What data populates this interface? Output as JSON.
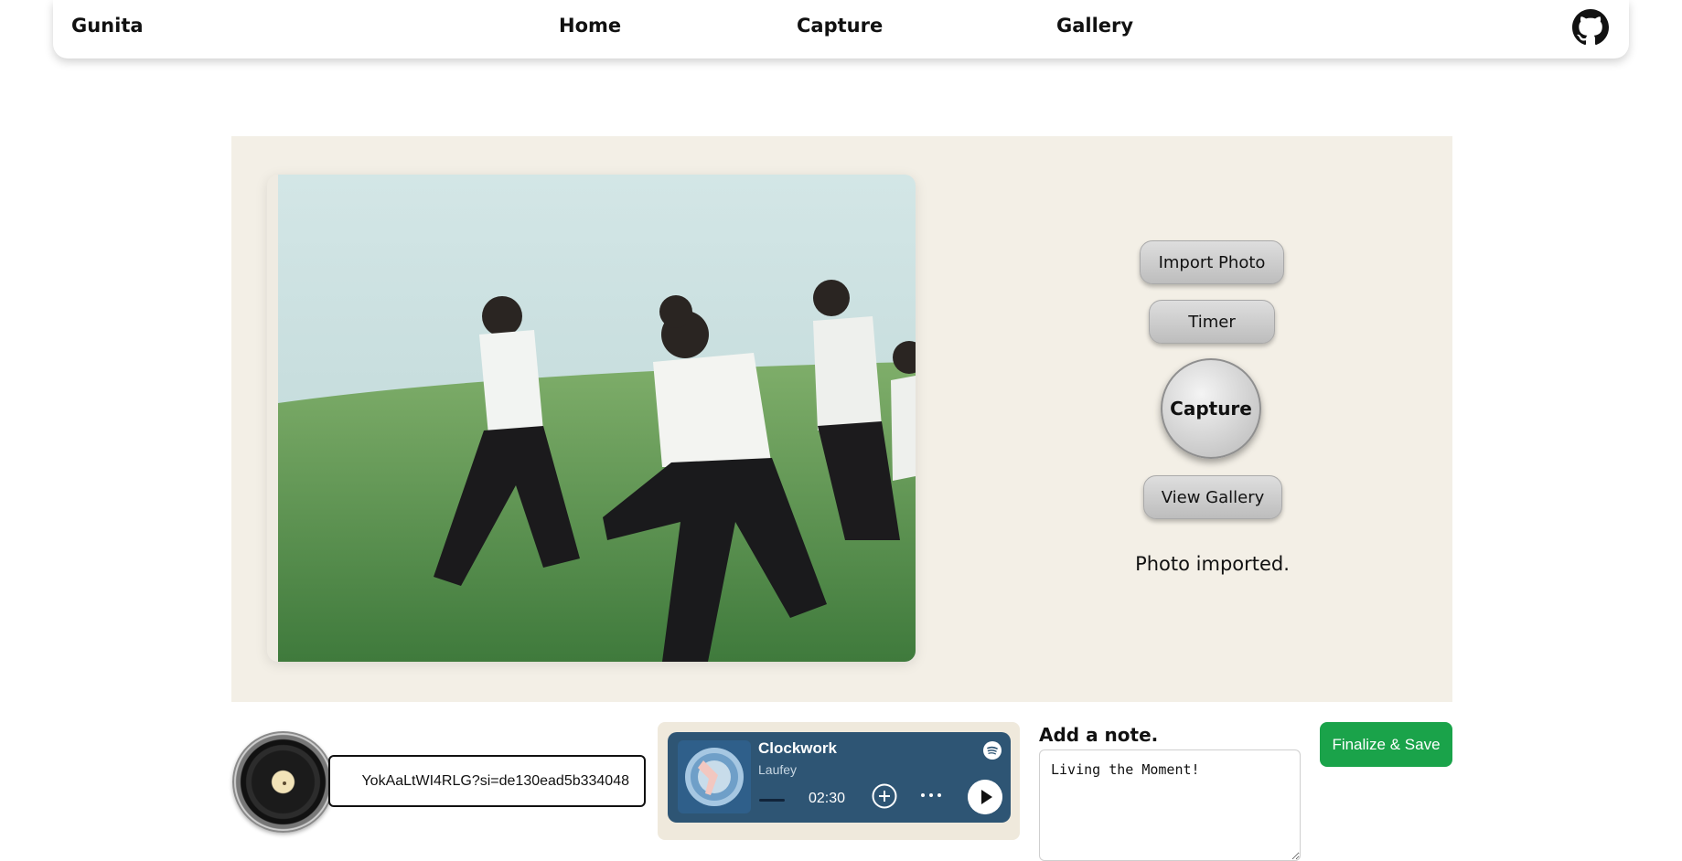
{
  "nav": {
    "brand": "Gunita",
    "links": [
      "Home",
      "Capture",
      "Gallery"
    ],
    "github_icon": "github-icon"
  },
  "capture": {
    "import_label": "Import Photo",
    "timer_label": "Timer",
    "capture_label": "Capture",
    "gallery_label": "View Gallery",
    "status": "Photo imported."
  },
  "music": {
    "link_value": "YokAaLtWI4RLG?si=de130ead5b334048",
    "track_title": "Clockwork",
    "track_artist": "Laufey",
    "time": "02:30"
  },
  "note": {
    "label": "Add a note.",
    "value": "Living the Moment!"
  },
  "finalize_label": "Finalize & Save",
  "colors": {
    "panel_bg": "#f3efe6",
    "spotify_bg": "#2e5574",
    "finalize_bg": "#1aa34a"
  }
}
